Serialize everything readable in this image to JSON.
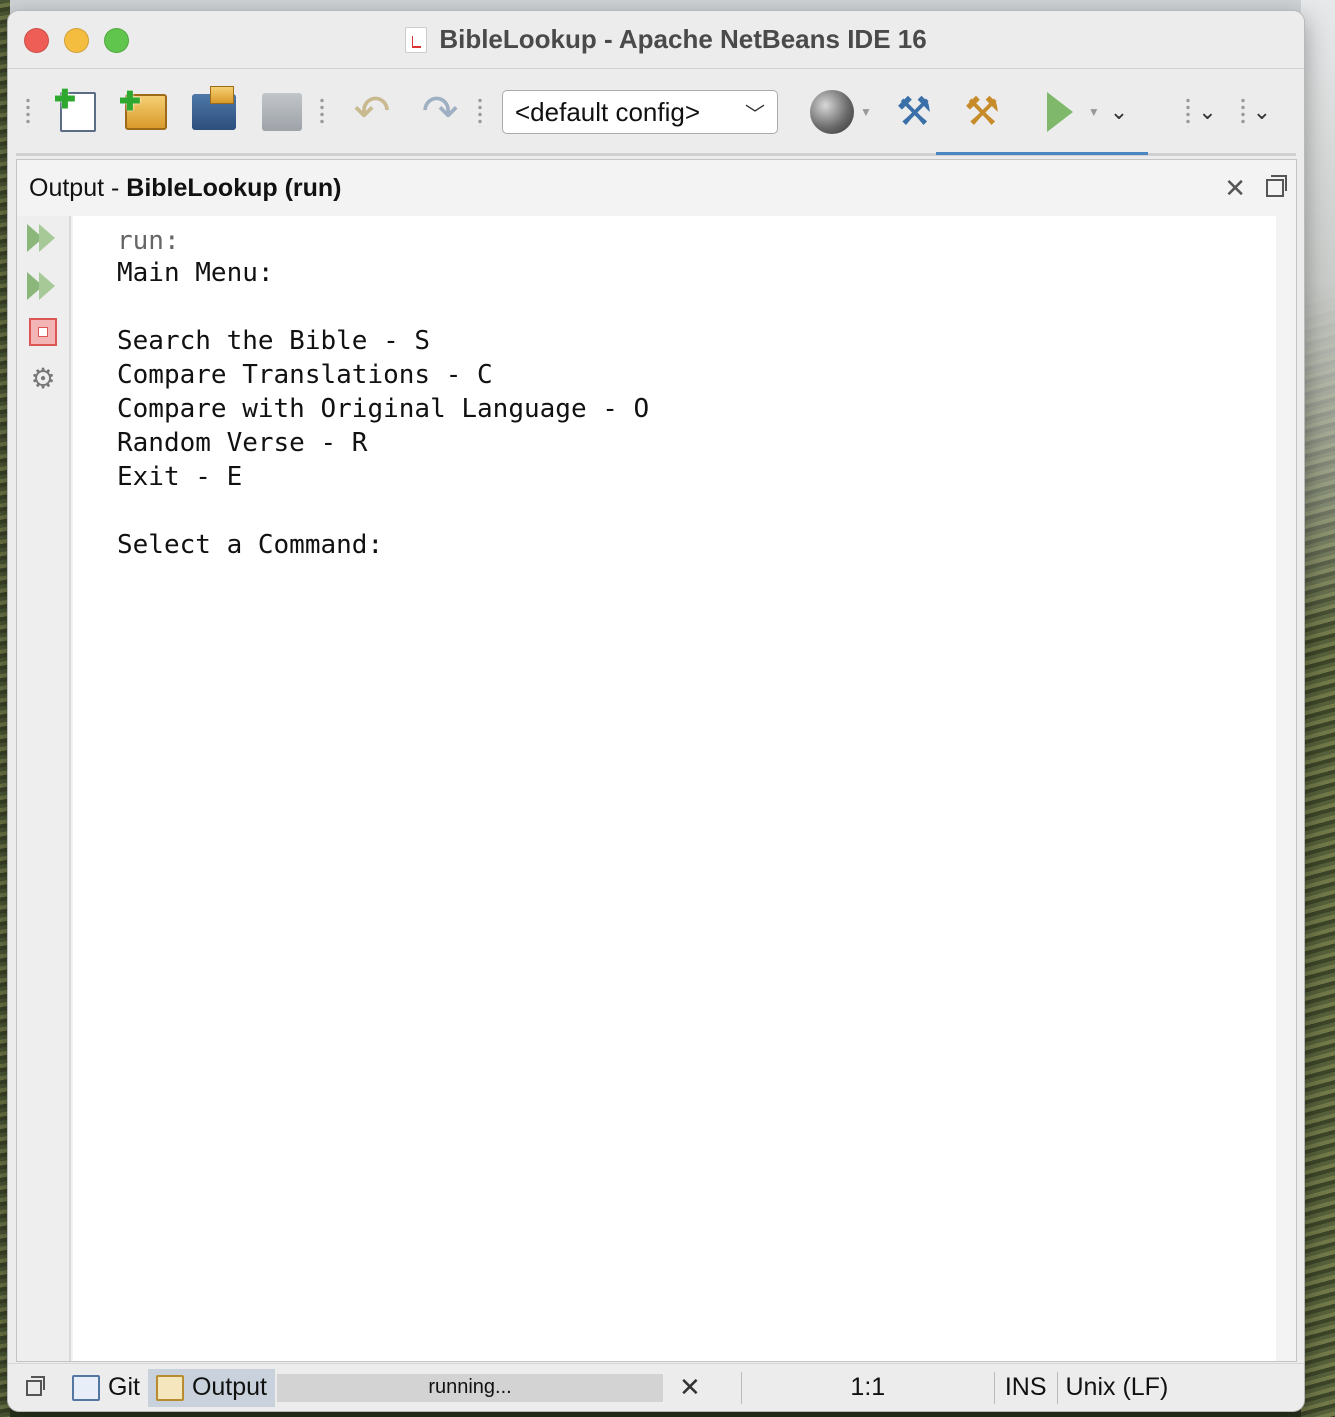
{
  "window": {
    "title": "BibleLookup - Apache NetBeans IDE 16"
  },
  "toolbar": {
    "config_select": "<default config>"
  },
  "output": {
    "header_prefix": "Output - ",
    "header_name": "BibleLookup (run)",
    "lines": [
      "run:",
      "Main Menu:",
      "",
      "Search the Bible - S",
      "Compare Translations - C",
      "Compare with Original Language - O",
      "Random Verse - R",
      "Exit - E",
      "",
      "Select a Command:"
    ]
  },
  "statusbar": {
    "git_tab": "Git",
    "output_tab": "Output",
    "progress_text": "running...",
    "caret_position": "1:1",
    "insert_mode": "INS",
    "line_endings": "Unix (LF)"
  },
  "colors": {
    "accent": "#4b86c3",
    "run_green": "#7fb86a",
    "stop_red": "#d55555"
  }
}
